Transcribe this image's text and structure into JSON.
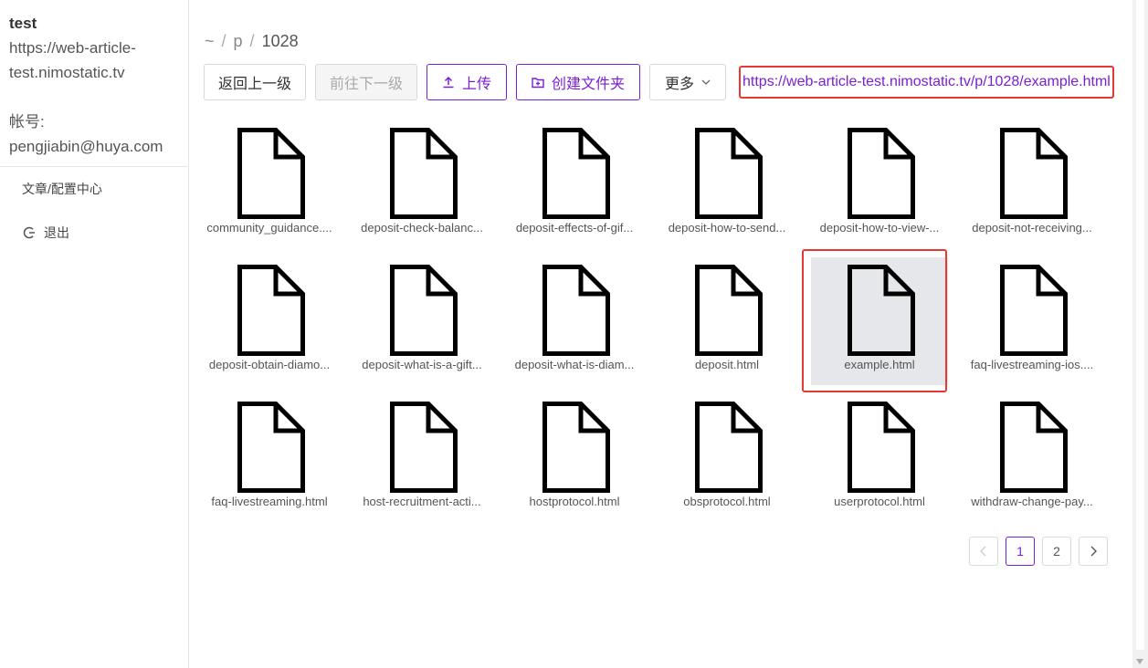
{
  "sidebar": {
    "title": "test",
    "url_line1": "https://web-article-",
    "url_line2": "test.nimostatic.tv",
    "account_label": "帐号:",
    "account_value": "pengjiabin@huya.com",
    "menu": [
      {
        "label": "文章/配置中心",
        "icon": ""
      },
      {
        "label": "退出",
        "icon": "logout-icon"
      }
    ]
  },
  "breadcrumb": {
    "root": "~",
    "sep": "/",
    "p": "p",
    "current": "1028"
  },
  "toolbar": {
    "back_label": "返回上一级",
    "forward_label": "前往下一级",
    "upload_label": "上传",
    "new_folder_label": "创建文件夹",
    "more_label": "更多",
    "url": "https://web-article-test.nimostatic.tv/p/1028/example.html"
  },
  "files": [
    "community_guidance....",
    "deposit-check-balanc...",
    "deposit-effects-of-gif...",
    "deposit-how-to-send...",
    "deposit-how-to-view-...",
    "deposit-not-receiving...",
    "deposit-obtain-diamo...",
    "deposit-what-is-a-gift...",
    "deposit-what-is-diam...",
    "deposit.html",
    "example.html",
    "faq-livestreaming-ios....",
    "faq-livestreaming.html",
    "host-recruitment-acti...",
    "hostprotocol.html",
    "obsprotocol.html",
    "userprotocol.html",
    "withdraw-change-pay..."
  ],
  "selected_file": "example.html",
  "pagination": {
    "prev": "<",
    "pages": [
      "1",
      "2"
    ],
    "current": "1",
    "next": ">"
  },
  "colors": {
    "accent": "#7b1fd0",
    "highlight": "#e53935",
    "selected_bg": "#e6e7ea"
  }
}
